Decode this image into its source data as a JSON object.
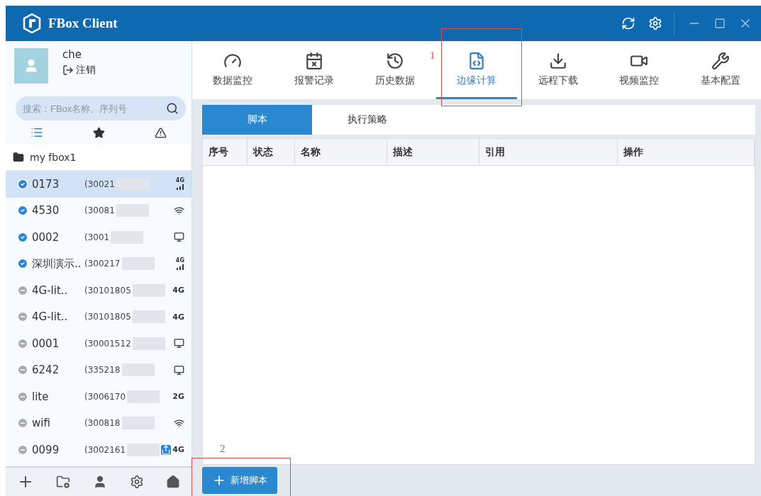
{
  "window": {
    "title": "FBox Client"
  },
  "user": {
    "name": "che",
    "logout": "注销"
  },
  "search": {
    "placeholder": "搜索：FBox名称、序列号"
  },
  "filters": [
    {
      "kind": "list",
      "selected": true
    },
    {
      "kind": "star",
      "selected": false
    },
    {
      "kind": "warning",
      "selected": false
    }
  ],
  "group": {
    "name": "my fbox1"
  },
  "devices": [
    {
      "name": "0173",
      "serial": "(30021",
      "online": true,
      "selected": true,
      "network": {
        "kind": "signal",
        "text": "4G"
      },
      "shared": false
    },
    {
      "name": "4530",
      "serial": "(30081",
      "online": true,
      "selected": false,
      "network": {
        "kind": "wireless"
      },
      "shared": false
    },
    {
      "name": "0002",
      "serial": "(3001",
      "online": true,
      "selected": false,
      "network": {
        "kind": "wired"
      },
      "shared": false
    },
    {
      "name": "深圳演示..",
      "serial": "(300217",
      "online": true,
      "selected": false,
      "network": {
        "kind": "signal",
        "text": "4G"
      },
      "shared": false
    },
    {
      "name": "4G-lit..",
      "serial": "(30101805",
      "online": false,
      "selected": false,
      "network": {
        "kind": "text",
        "text": "4G"
      },
      "shared": false
    },
    {
      "name": "4G-lit..",
      "serial": "(30101805",
      "online": false,
      "selected": false,
      "network": {
        "kind": "text",
        "text": "4G"
      },
      "shared": false
    },
    {
      "name": "0001",
      "serial": "(30001512",
      "online": false,
      "selected": false,
      "network": {
        "kind": "wired"
      },
      "shared": false
    },
    {
      "name": "6242",
      "serial": "(335218",
      "online": false,
      "selected": false,
      "network": {
        "kind": "wired"
      },
      "shared": false
    },
    {
      "name": "lite",
      "serial": "(3006170",
      "online": false,
      "selected": false,
      "network": {
        "kind": "text",
        "text": "2G"
      },
      "shared": false
    },
    {
      "name": "wifi",
      "serial": "(300818",
      "online": false,
      "selected": false,
      "network": {
        "kind": "wireless"
      },
      "shared": false
    },
    {
      "name": "0099",
      "serial": "(3002161",
      "online": false,
      "selected": false,
      "network": {
        "kind": "text",
        "text": "4G"
      },
      "shared": true
    }
  ],
  "nav": [
    {
      "kind": "monitor",
      "label": "数据监控",
      "selected": false
    },
    {
      "kind": "alarm",
      "label": "报警记录",
      "selected": false
    },
    {
      "kind": "history",
      "label": "历史数据",
      "selected": false
    },
    {
      "kind": "edge",
      "label": "边缘计算",
      "selected": true
    },
    {
      "kind": "download",
      "label": "远程下载",
      "selected": false
    },
    {
      "kind": "video",
      "label": "视频监控",
      "selected": false
    },
    {
      "kind": "config",
      "label": "基本配置",
      "selected": false
    }
  ],
  "subtabs": [
    {
      "label": "脚本",
      "selected": true
    },
    {
      "label": "执行策略",
      "selected": false
    }
  ],
  "table": {
    "columns": [
      "序号",
      "状态",
      "名称",
      "描述",
      "引用",
      "操作"
    ]
  },
  "add_button": "新增脚本",
  "annotations": [
    "1",
    "2"
  ]
}
